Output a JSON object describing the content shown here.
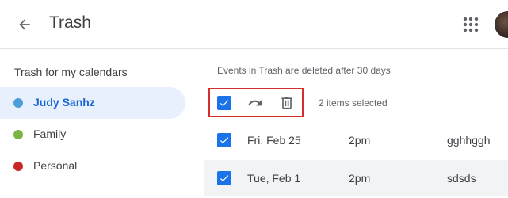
{
  "header": {
    "title": "Trash",
    "back_icon": "arrow-back-icon",
    "apps_icon": "google-apps-icon",
    "avatar": "user-avatar"
  },
  "sidebar": {
    "heading": "Trash for my calendars",
    "items": [
      {
        "label": "Judy Sanhz",
        "color": "#4a9fd8",
        "active": true
      },
      {
        "label": "Family",
        "color": "#7cb342",
        "active": false
      },
      {
        "label": "Personal",
        "color": "#c62828",
        "active": false
      }
    ]
  },
  "main": {
    "note": "Events in Trash are deleted after 30 days",
    "toolbar": {
      "select_all_icon": "checkbox-checked-icon",
      "restore_icon": "undo-icon",
      "delete_icon": "trash-icon",
      "selected_count": "2 items selected"
    },
    "rows": [
      {
        "date": "Fri, Feb 25",
        "time": "2pm",
        "name": "gghhggh",
        "checked": true
      },
      {
        "date": "Tue, Feb 1",
        "time": "2pm",
        "name": "sdsds",
        "checked": true
      }
    ]
  },
  "colors": {
    "accent": "#1a73e8",
    "highlight_box": "#d32f2f",
    "active_bg": "#e8f0fe"
  }
}
